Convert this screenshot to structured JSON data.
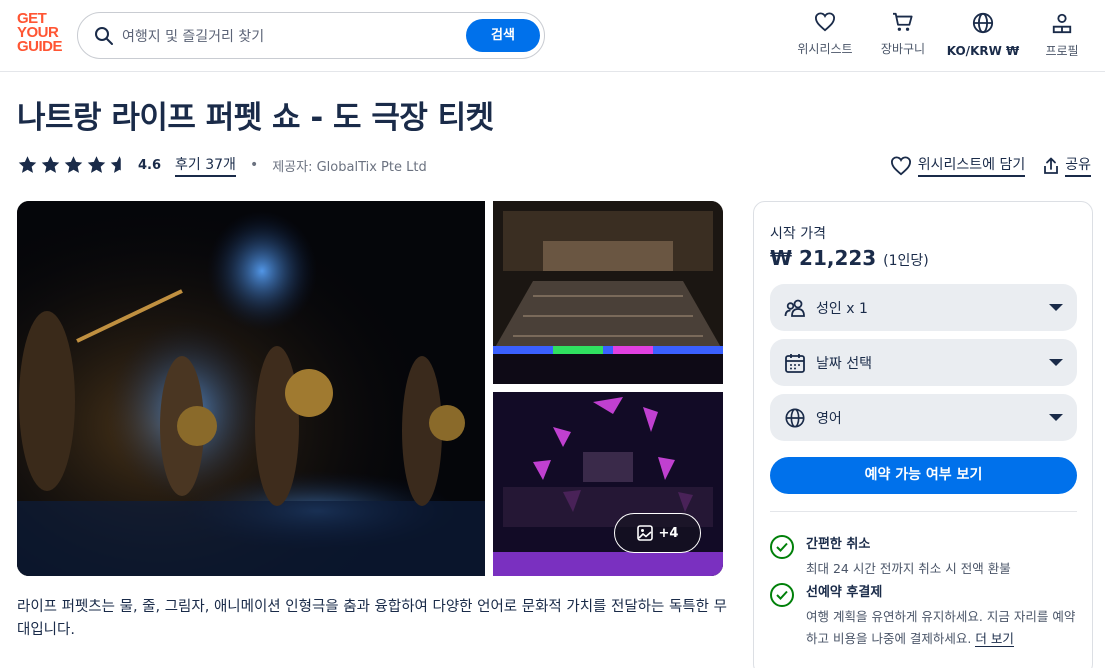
{
  "header": {
    "logo_lines": [
      "GET",
      "YOUR",
      "GUIDE"
    ],
    "search_placeholder": "여행지 및 즐길거리 찾기",
    "search_button": "검색",
    "nav": [
      {
        "label": "위시리스트",
        "icon": "heart-icon"
      },
      {
        "label": "장바구니",
        "icon": "cart-icon"
      },
      {
        "label": "KO/KRW ₩",
        "icon": "globe-icon"
      },
      {
        "label": "프로필",
        "icon": "profile-icon"
      }
    ]
  },
  "product": {
    "title": "나트랑 라이프 퍼펫 쇼 - 도 극장 티켓",
    "rating": "4.6",
    "rating_value": 4.6,
    "reviews": "후기 37개",
    "separator": "•",
    "provider": "제공자: GlobalTix Pte Ltd",
    "wishlist": "위시리스트에 담기",
    "share": "공유",
    "more_photos": "+4",
    "description": "라이프 퍼펫츠는 물, 줄, 그림자, 애니메이션 인형극을 춤과 융합하여 다양한 언어로 문화적 가치를 전달하는 독특한 무대입니다."
  },
  "booking": {
    "from_label": "시작 가격",
    "price": "₩ 21,223",
    "per_person": "(1인당)",
    "participants": "성인 x 1",
    "date": "날짜 선택",
    "language": "영어",
    "check_button": "예약 가능 여부 보기",
    "features": [
      {
        "title": "간편한 취소",
        "desc": "최대 24 시간 전까지 취소 시 전액 환불"
      },
      {
        "title": "선예약 후결제",
        "desc": "여행 계획을 유연하게 유지하세요. 지금 자리를 예약하고 비용을 나중에 결제하세요.",
        "link": "더 보기"
      }
    ]
  },
  "colors": {
    "brand": "#ff5533",
    "accent": "#0071eb",
    "text": "#1a2b49",
    "success": "#008009"
  }
}
